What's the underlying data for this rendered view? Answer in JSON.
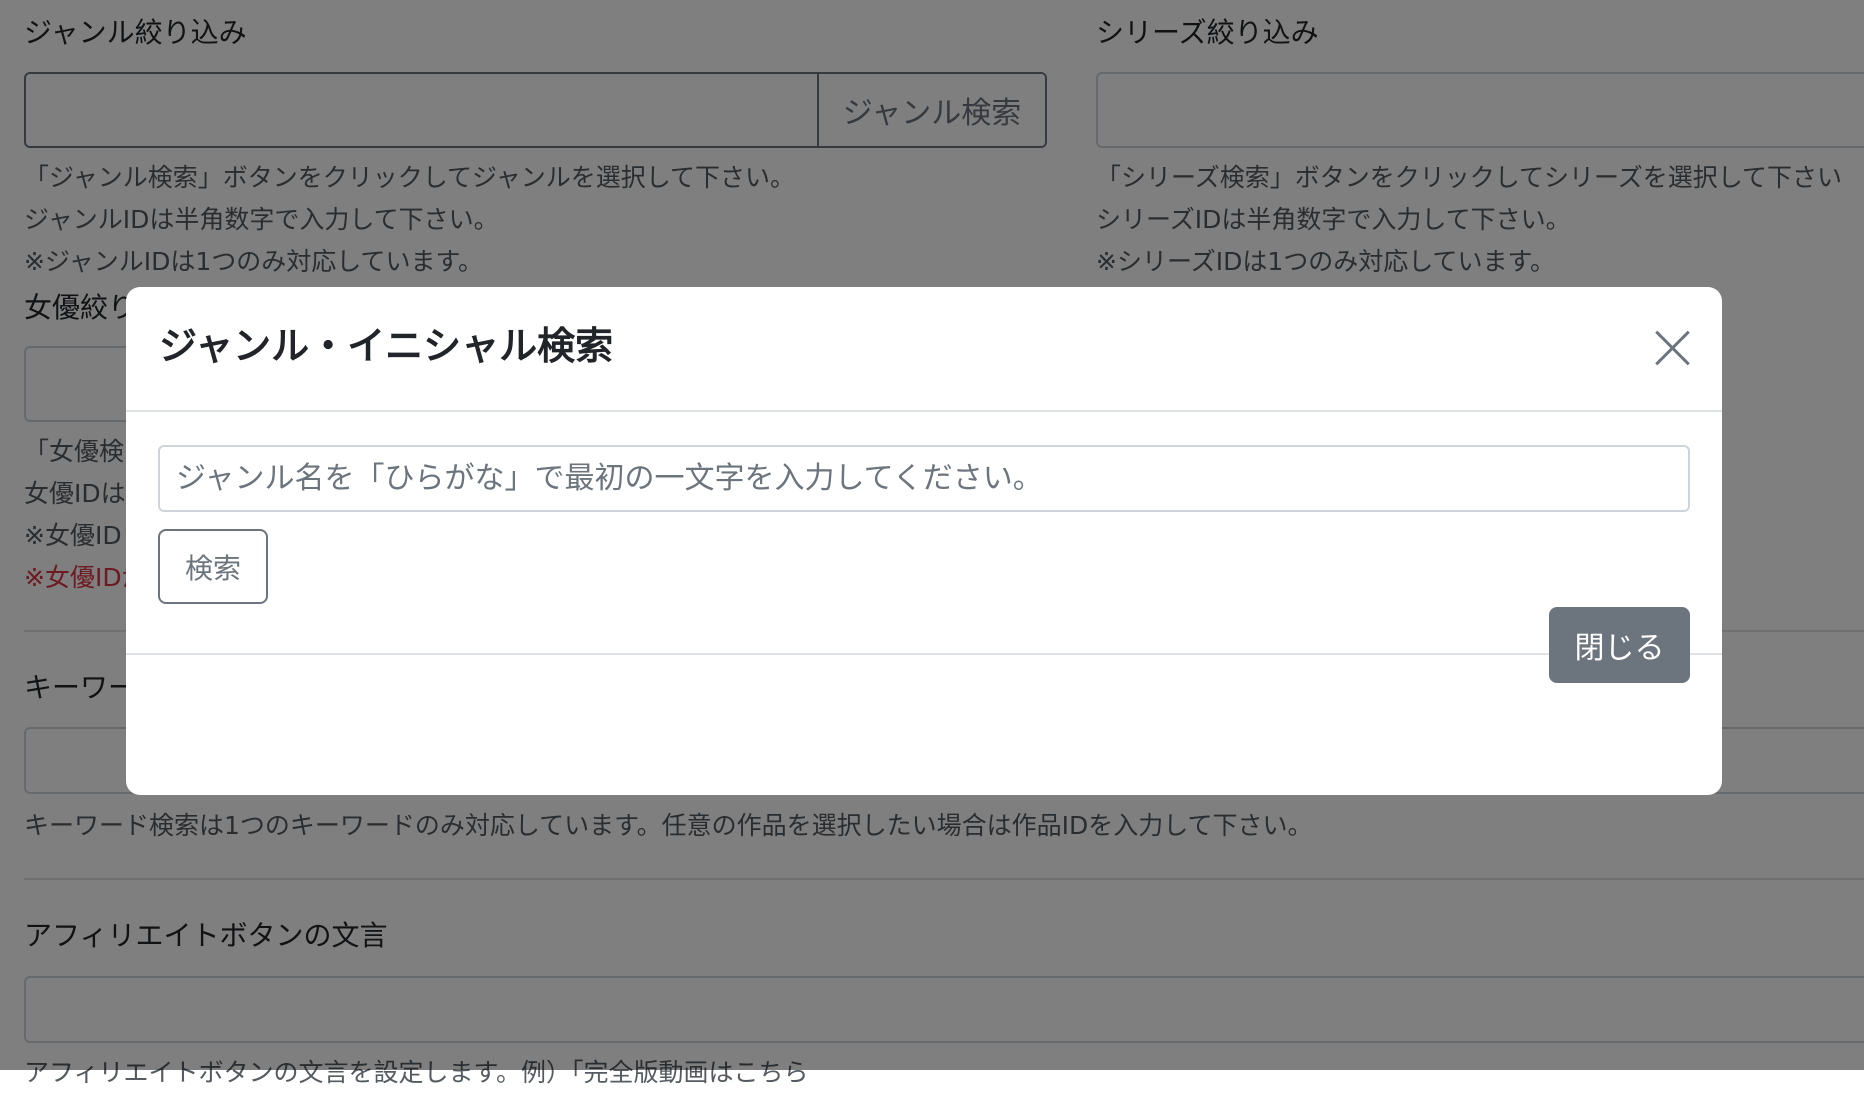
{
  "genre_filter": {
    "label": "ジャンル絞り込み",
    "button": "ジャンル検索",
    "help": [
      "「ジャンル検索」ボタンをクリックしてジャンルを選択して下さい。",
      "ジャンルIDは半角数字で入力して下さい。",
      "※ジャンルIDは1つのみ対応しています。"
    ]
  },
  "series_filter": {
    "label": "シリーズ絞り込み",
    "help": [
      "「シリーズ検索」ボタンをクリックしてシリーズを選択して下さい",
      "シリーズIDは半角数字で入力して下さい。",
      "※シリーズIDは1つのみ対応しています。"
    ]
  },
  "actress_filter": {
    "label": "女優絞り",
    "help": [
      "「女優検",
      "女優IDは",
      "※女優ID",
      "※女優IDが"
    ]
  },
  "keyword": {
    "label": "キーワー",
    "help": "キーワード検索は1つのキーワードのみ対応しています。任意の作品を選択したい場合は作品IDを入力して下さい。"
  },
  "affiliate": {
    "label": "アフィリエイトボタンの文言",
    "help": "アフィリエイトボタンの文言を設定します。例）「完全版動画はこちら"
  },
  "modal": {
    "title": "ジャンル・イニシャル検索",
    "input_placeholder": "ジャンル名を「ひらがな」で最初の一文字を入力してください。",
    "search_button": "検索",
    "close_button": "閉じる"
  },
  "icons": {
    "close": "close-icon"
  },
  "colors": {
    "secondary": "#6c757d",
    "danger": "#dc3545",
    "backdrop": "rgba(0,0,0,0.5)"
  }
}
